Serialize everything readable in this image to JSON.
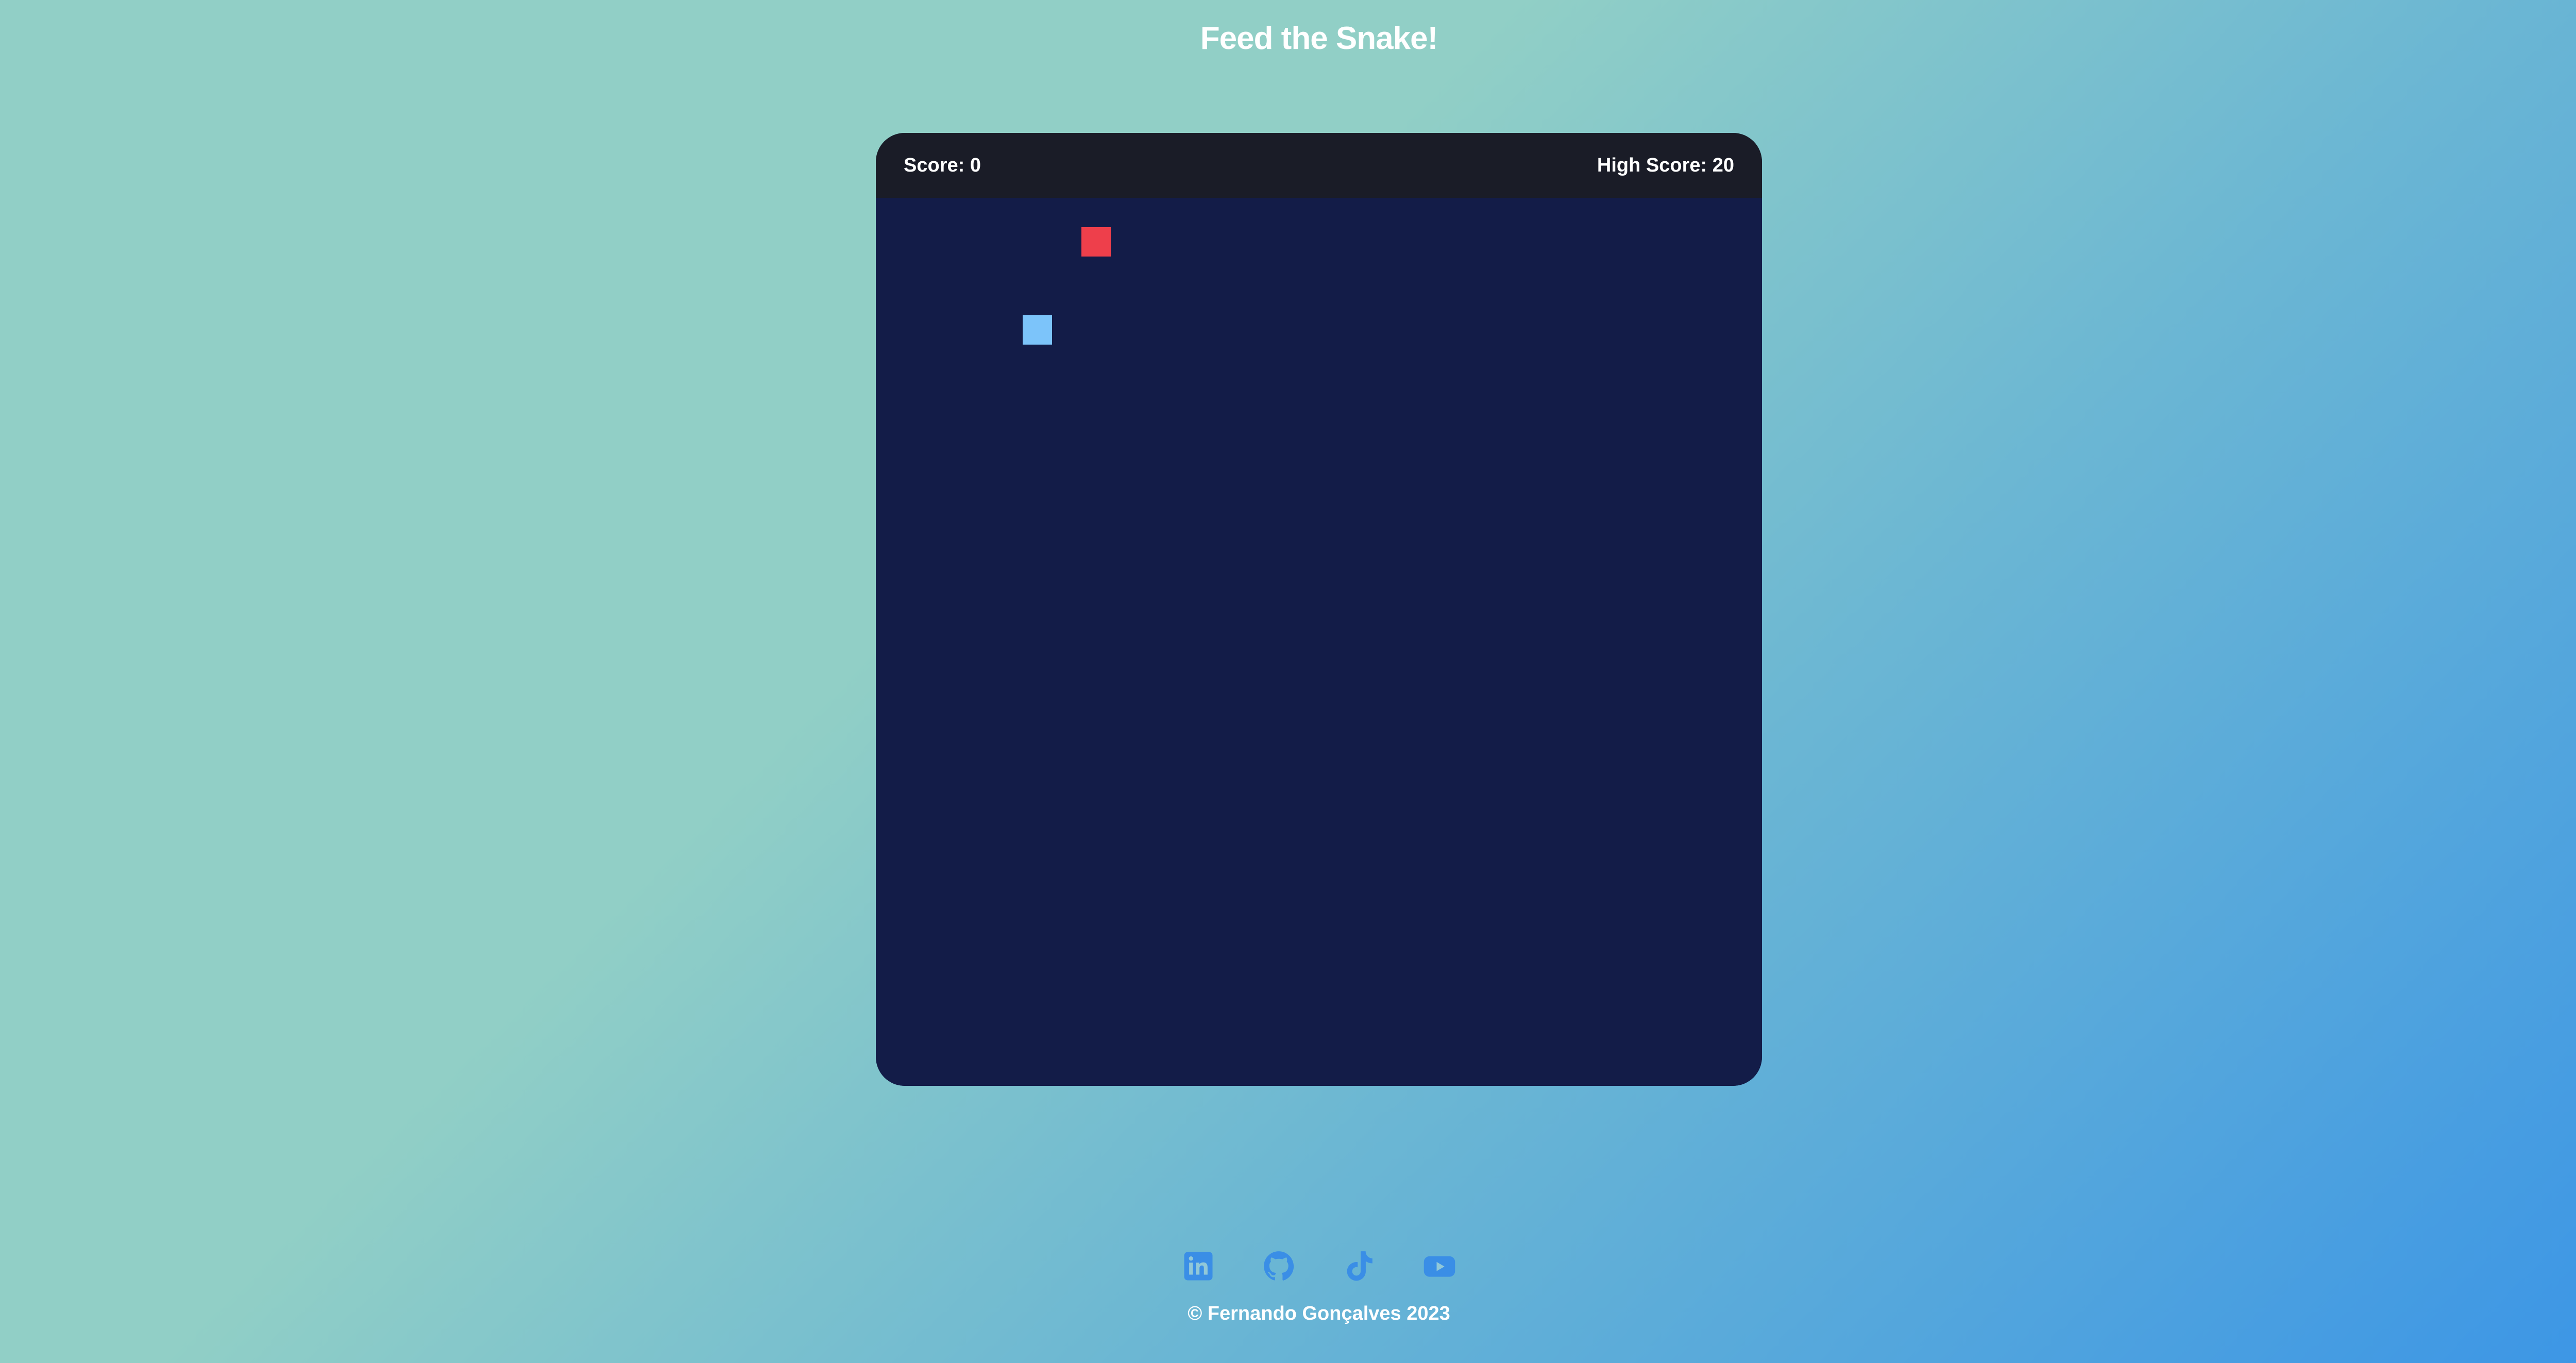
{
  "page": {
    "title": "Feed the Snake!"
  },
  "game": {
    "score_label": "Score: 0",
    "high_score_label": "High Score: 20",
    "score": 0,
    "high_score": 20,
    "board_color": "#131c48",
    "scorebar_color": "#1a1c27",
    "snake": {
      "color": "#7cc4fa",
      "segments": [
        {
          "col": 4,
          "row": 3
        }
      ]
    },
    "food": {
      "color": "#ee3f4b",
      "col": 6,
      "row": 0
    },
    "grid": {
      "cols": 30,
      "rows": 30
    }
  },
  "footer": {
    "icon_color": "#3a8ee6",
    "social_links": [
      {
        "name": "linkedin-icon"
      },
      {
        "name": "github-icon"
      },
      {
        "name": "tiktok-icon"
      },
      {
        "name": "youtube-icon"
      }
    ],
    "copyright": "© Fernando Gonçalves 2023"
  }
}
